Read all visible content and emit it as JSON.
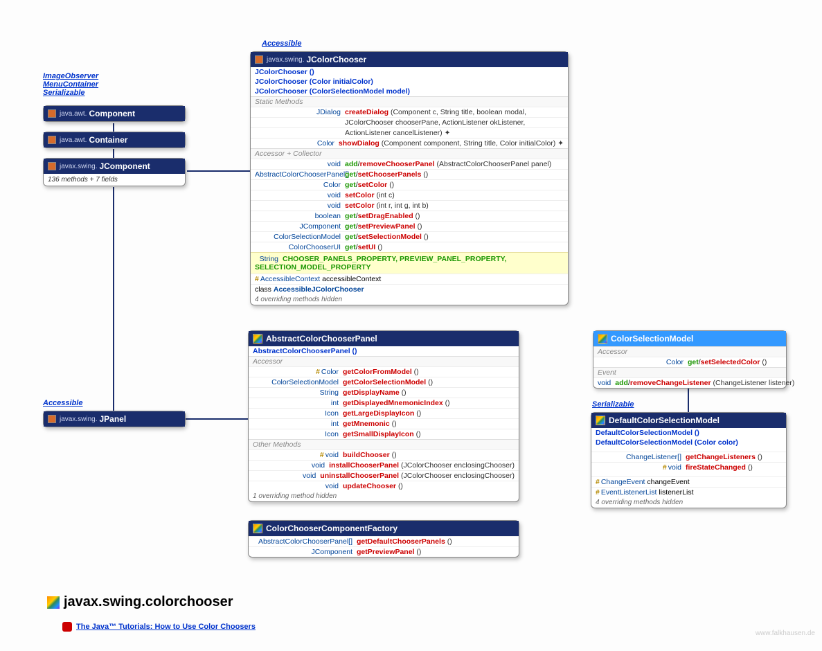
{
  "diagram": {
    "package_title": "javax.swing.colorchooser",
    "tutorial_link": "The Java™ Tutorials: How to Use Color Choosers",
    "watermark": "www.falkhausen.de"
  },
  "hierarchy": {
    "interfaces": [
      "ImageObserver",
      "MenuContainer",
      "Serializable"
    ],
    "component": {
      "pkg": "java.awt.",
      "name": "Component"
    },
    "container": {
      "pkg": "java.awt.",
      "name": "Container"
    },
    "jcomponent": {
      "pkg": "javax.swing.",
      "name": "JComponent",
      "note": "136 methods + 7 fields"
    },
    "jpanel_label": "Accessible",
    "jpanel": {
      "pkg": "javax.swing.",
      "name": "JPanel"
    }
  },
  "jcolorchooser": {
    "label": "Accessible",
    "pkg": "javax.swing.",
    "name": "JColorChooser",
    "constructors": [
      "JColorChooser ()",
      "JColorChooser (Color initialColor)",
      "JColorChooser (ColorSelectionModel model)"
    ],
    "section1": "Static Methods",
    "createDialog": {
      "ret": "JDialog",
      "name": "createDialog",
      "p1": "(Component c, String title, boolean modal,",
      "p2": "JColorChooser chooserPane, ActionListener okListener,",
      "p3": "ActionListener cancelListener) ✦"
    },
    "showDialog": {
      "ret": "Color",
      "name": "showDialog",
      "p": "(Component component, String title, Color initialColor) ✦"
    },
    "section2": "Accessor + Collector",
    "rows": [
      {
        "ret": "void",
        "gs": true,
        "g": "add",
        "s": "removeChooserPanel",
        "p": "(AbstractColorChooserPanel panel)"
      },
      {
        "ret": "AbstractColorChooserPanel[]",
        "gs": true,
        "g": "get",
        "s": "setChooserPanels",
        "p": "()"
      },
      {
        "ret": "Color",
        "gs": true,
        "g": "get",
        "s": "setColor",
        "p": "()"
      },
      {
        "ret": "void",
        "name": "setColor",
        "p": "(int c)"
      },
      {
        "ret": "void",
        "name": "setColor",
        "p": "(int r, int g, int b)"
      },
      {
        "ret": "boolean",
        "gs": true,
        "g": "get",
        "s": "setDragEnabled",
        "p": "()"
      },
      {
        "ret": "JComponent",
        "gs": true,
        "g": "get",
        "s": "setPreviewPanel",
        "p": "()"
      },
      {
        "ret": "ColorSelectionModel",
        "gs": true,
        "g": "get",
        "s": "setSelectionModel",
        "p": "()"
      },
      {
        "ret": "ColorChooserUI",
        "gs": true,
        "g": "get",
        "s": "setUI",
        "p": "()"
      }
    ],
    "consts": {
      "ret": "String",
      "vals": "CHOOSER_PANELS_PROPERTY, PREVIEW_PANEL_PROPERTY, SELECTION_MODEL_PROPERTY"
    },
    "field": {
      "protected": true,
      "ret": "AccessibleContext",
      "name": "accessibleContext"
    },
    "inner": {
      "kw": "class",
      "name": "AccessibleJColorChooser"
    },
    "foot": "4 overriding methods hidden"
  },
  "abstractpanel": {
    "name": "AbstractColorChooserPanel",
    "constructors": [
      "AbstractColorChooserPanel ()"
    ],
    "section1": "Accessor",
    "rows1": [
      {
        "protected": true,
        "ret": "Color",
        "name": "getColorFromModel",
        "p": "()"
      },
      {
        "ret": "ColorSelectionModel",
        "name": "getColorSelectionModel",
        "p": "()"
      },
      {
        "ret": "String",
        "name": "getDisplayName",
        "p": "()"
      },
      {
        "ret": "int",
        "name": "getDisplayedMnemonicIndex",
        "p": "()"
      },
      {
        "ret": "Icon",
        "name": "getLargeDisplayIcon",
        "p": "()"
      },
      {
        "ret": "int",
        "name": "getMnemonic",
        "p": "()"
      },
      {
        "ret": "Icon",
        "name": "getSmallDisplayIcon",
        "p": "()"
      }
    ],
    "section2": "Other Methods",
    "rows2": [
      {
        "protected": true,
        "ret": "void",
        "name": "buildChooser",
        "p": "()"
      },
      {
        "ret": "void",
        "name": "installChooserPanel",
        "p": "(JColorChooser enclosingChooser)"
      },
      {
        "ret": "void",
        "name": "uninstallChooserPanel",
        "p": "(JColorChooser enclosingChooser)"
      },
      {
        "ret": "void",
        "name": "updateChooser",
        "p": "()"
      }
    ],
    "foot": "1 overriding method hidden"
  },
  "factory": {
    "name": "ColorChooserComponentFactory",
    "rows": [
      {
        "ret": "AbstractColorChooserPanel[]",
        "name": "getDefaultChooserPanels",
        "p": "()"
      },
      {
        "ret": "JComponent",
        "name": "getPreviewPanel",
        "p": "()"
      }
    ]
  },
  "csm": {
    "name": "ColorSelectionModel",
    "section1": "Accessor",
    "rows1": [
      {
        "ret": "Color",
        "gs": true,
        "g": "get",
        "s": "setSelectedColor",
        "p": "()"
      }
    ],
    "section2": "Event",
    "rows2": [
      {
        "ret": "void",
        "gs": true,
        "g": "add",
        "s": "removeChangeListener",
        "p": "(ChangeListener listener)"
      }
    ]
  },
  "defcsm": {
    "label": "Serializable",
    "name": "DefaultColorSelectionModel",
    "constructors": [
      "DefaultColorSelectionModel ()",
      "DefaultColorSelectionModel (Color color)"
    ],
    "rows": [
      {
        "ret": "ChangeListener[]",
        "name": "getChangeListeners",
        "p": "()"
      },
      {
        "protected": true,
        "ret": "void",
        "name": "fireStateChanged",
        "p": "()"
      }
    ],
    "fields": [
      {
        "protected": true,
        "ret": "ChangeEvent",
        "name": "changeEvent"
      },
      {
        "protected": true,
        "ret": "EventListenerList",
        "name": "listenerList"
      }
    ],
    "foot": "4 overriding methods hidden"
  }
}
